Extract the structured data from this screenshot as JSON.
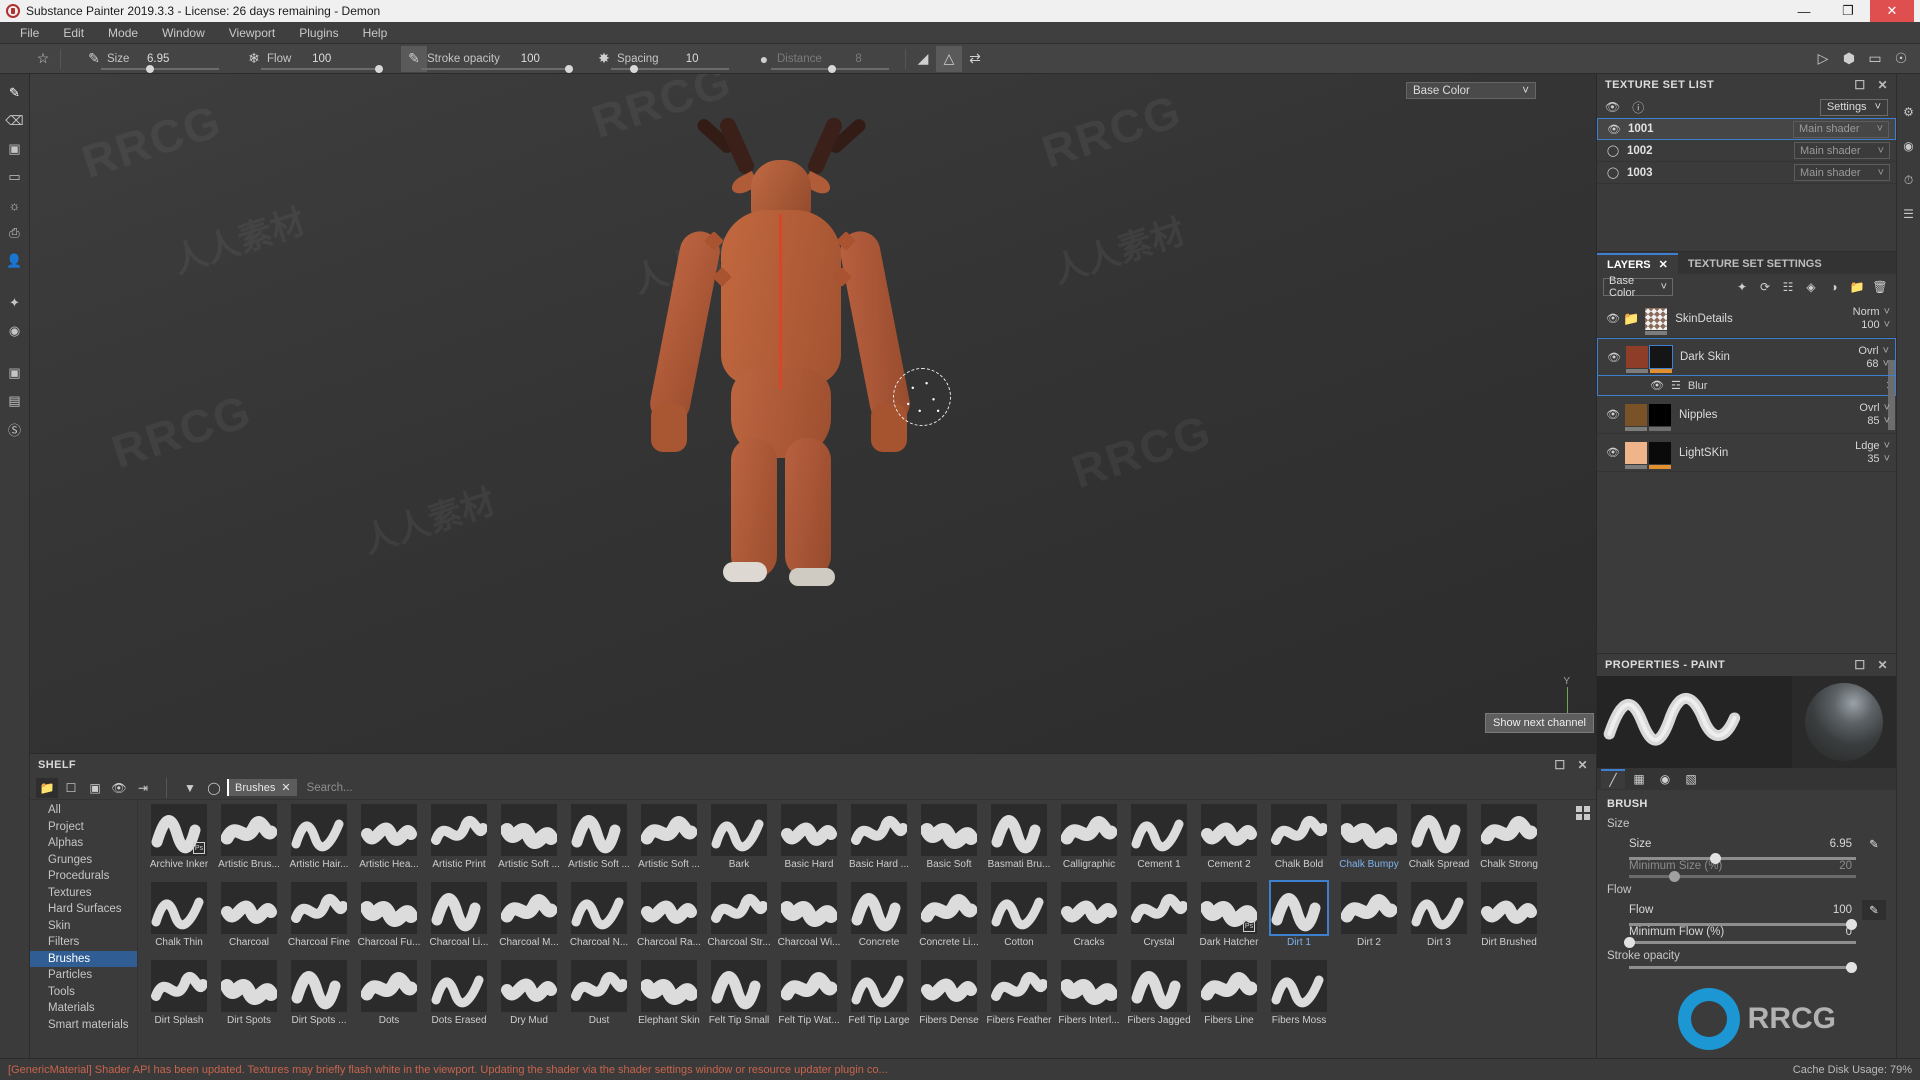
{
  "titlebar": {
    "title": "Substance Painter 2019.3.3 - License: 26 days remaining - Demon",
    "minimize": "—",
    "maximize": "❐",
    "close": "✕"
  },
  "menubar": {
    "items": [
      "File",
      "Edit",
      "Mode",
      "Window",
      "Viewport",
      "Plugins",
      "Help"
    ]
  },
  "toolbar": {
    "params": [
      {
        "label": "Size",
        "value": "6.95",
        "fill": 38,
        "dim": false
      },
      {
        "label": "Flow",
        "value": "100",
        "fill": 97,
        "dim": false
      },
      {
        "label": "Stroke opacity",
        "value": "100",
        "fill": 97,
        "dim": false
      },
      {
        "label": "Spacing",
        "value": "10",
        "fill": 16,
        "dim": false
      },
      {
        "label": "Distance",
        "value": "8",
        "fill": 48,
        "dim": true
      }
    ],
    "icons": {
      "brush": "brush-icon",
      "star": "star-shape-icon",
      "flow_brush": "flow-brush-icon",
      "opacity_brush": "opacity-brush-icon",
      "spacing_dots": "spacing-dots-icon",
      "distance": "distance-icon",
      "curve": "curve-icon",
      "symmetry": "symmetry-icon",
      "symmetry_transform": "symmetry-transform-icon"
    },
    "right_icons": [
      "viewport-layout-icon",
      "material-sphere-icon",
      "camera-view-icon",
      "screenshot-icon"
    ]
  },
  "leftrail": {
    "items": [
      "paint-tool-icon",
      "eraser-tool-icon",
      "projection-tool-icon",
      "polygon-fill-icon",
      "smudge-tool-icon",
      "clone-tool-icon",
      "material-picker-icon",
      "particle-tool-icon",
      "physical-paint-icon",
      "photoshop-bridge-icon",
      "document-icon",
      "substance-icon"
    ]
  },
  "viewport": {
    "channel_dropdown": "Base Color",
    "axis_label": "Y",
    "tooltip": "Show next channel"
  },
  "shelf": {
    "title": "SHELF",
    "tools": [
      "folder-icon",
      "new-file-icon",
      "save-icon",
      "hide-icon",
      "import-icon"
    ],
    "filter_icons": [
      "filter-funnel-icon",
      "circle-icon"
    ],
    "filter_tag": "Brushes",
    "search_placeholder": "Search...",
    "categories": [
      "All",
      "Project",
      "Alphas",
      "Grunges",
      "Procedurals",
      "Textures",
      "Hard Surfaces",
      "Skin",
      "Filters",
      "Brushes",
      "Particles",
      "Tools",
      "Materials",
      "Smart materials"
    ],
    "selected_category": "Brushes",
    "selected_brush": "Dirt 1",
    "brushes": [
      {
        "name": "Archive Inker",
        "ps": true
      },
      {
        "name": "Artistic Brus..."
      },
      {
        "name": "Artistic Hair..."
      },
      {
        "name": "Artistic Hea..."
      },
      {
        "name": "Artistic Print"
      },
      {
        "name": "Artistic Soft ..."
      },
      {
        "name": "Artistic Soft ..."
      },
      {
        "name": "Artistic Soft ..."
      },
      {
        "name": "Bark"
      },
      {
        "name": "Basic Hard"
      },
      {
        "name": "Basic Hard ..."
      },
      {
        "name": "Basic Soft"
      },
      {
        "name": "Basmati Bru..."
      },
      {
        "name": "Calligraphic"
      },
      {
        "name": "Cement 1"
      },
      {
        "name": "Cement 2"
      },
      {
        "name": "Chalk Bold"
      },
      {
        "name": "Chalk Bumpy",
        "highlight": true
      },
      {
        "name": "Chalk Spread"
      },
      {
        "name": "Chalk Strong"
      },
      {
        "name": "Chalk Thin"
      },
      {
        "name": "Charcoal"
      },
      {
        "name": "Charcoal Fine"
      },
      {
        "name": "Charcoal Fu..."
      },
      {
        "name": "Charcoal Li..."
      },
      {
        "name": "Charcoal M..."
      },
      {
        "name": "Charcoal N..."
      },
      {
        "name": "Charcoal Ra..."
      },
      {
        "name": "Charcoal Str..."
      },
      {
        "name": "Charcoal Wi..."
      },
      {
        "name": "Concrete"
      },
      {
        "name": "Concrete Li..."
      },
      {
        "name": "Cotton"
      },
      {
        "name": "Cracks"
      },
      {
        "name": "Crystal"
      },
      {
        "name": "Dark Hatcher",
        "ps": true
      },
      {
        "name": "Dirt 1",
        "selected": true
      },
      {
        "name": "Dirt 2"
      },
      {
        "name": "Dirt 3"
      },
      {
        "name": "Dirt Brushed"
      },
      {
        "name": "Dirt Splash"
      },
      {
        "name": "Dirt Spots"
      },
      {
        "name": "Dirt Spots ..."
      },
      {
        "name": "Dots"
      },
      {
        "name": "Dots Erased"
      },
      {
        "name": "Dry Mud"
      },
      {
        "name": "Dust"
      },
      {
        "name": "Elephant Skin"
      },
      {
        "name": "Felt Tip Small"
      },
      {
        "name": "Felt Tip Wat..."
      },
      {
        "name": "Fetl Tip Large"
      },
      {
        "name": "Fibers Dense"
      },
      {
        "name": "Fibers Feather"
      },
      {
        "name": "Fibers Interl..."
      },
      {
        "name": "Fibers Jagged"
      },
      {
        "name": "Fibers Line"
      },
      {
        "name": "Fibers Moss"
      }
    ]
  },
  "texture_set_list": {
    "title": "TEXTURE SET LIST",
    "settings_label": "Settings",
    "tool_icons": [
      "eye-check-icon",
      "info-circle-icon"
    ],
    "rows": [
      {
        "name": "1001",
        "shader": "Main shader",
        "visible": true,
        "selected": true
      },
      {
        "name": "1002",
        "shader": "Main shader",
        "visible": false,
        "selected": false
      },
      {
        "name": "1003",
        "shader": "Main shader",
        "visible": false,
        "selected": false
      }
    ]
  },
  "layers_panel": {
    "tabs": [
      {
        "label": "LAYERS",
        "active": true,
        "closable": true
      },
      {
        "label": "TEXTURE SET SETTINGS",
        "active": false,
        "closable": false
      }
    ],
    "channel": "Base Color",
    "tool_icons": [
      "magic-wand-icon",
      "add-effect-icon",
      "add-fill-layer-icon",
      "add-paint-layer-icon",
      "add-adjustment-icon",
      "add-folder-icon",
      "delete-icon"
    ],
    "layers": [
      {
        "name": "SkinDetails",
        "blend": "Norm",
        "opacity": "100",
        "type": "folder",
        "visible": true,
        "selected": false,
        "thumb": "checker"
      },
      {
        "name": "Dark Skin",
        "blend": "Ovrl",
        "opacity": "68",
        "type": "paint",
        "visible": true,
        "selected": true,
        "thumb": "darkskin",
        "effects": [
          {
            "name": "Blur",
            "visible": true,
            "icon": "blur-icon"
          }
        ]
      },
      {
        "name": "Nipples",
        "blend": "Ovrl",
        "opacity": "85",
        "type": "paint",
        "visible": true,
        "selected": false,
        "thumb": "nipples"
      },
      {
        "name": "LightSKin",
        "blend": "Ldge",
        "opacity": "35",
        "type": "paint",
        "visible": true,
        "selected": false,
        "thumb": "lightskin"
      }
    ]
  },
  "properties": {
    "title": "PROPERTIES - PAINT",
    "tabs": [
      "brush-tab-icon",
      "alpha-tab-icon",
      "stencil-tab-icon",
      "gradient-tab-icon"
    ],
    "section": "BRUSH",
    "groups": [
      {
        "label": "Size",
        "rows": [
          {
            "label": "Size",
            "value": "6.95",
            "fill": 38,
            "dim": false,
            "button": "size-jitter-icon"
          },
          {
            "label": "Minimum Size (%)",
            "value": "20",
            "fill": 20,
            "dim": true
          }
        ]
      },
      {
        "label": "Flow",
        "rows": [
          {
            "label": "Flow",
            "value": "100",
            "fill": 98,
            "dim": false,
            "button": "flow-jitter-icon",
            "button_on": true
          },
          {
            "label": "Minimum Flow (%)",
            "value": "0",
            "fill": 0,
            "dim": false
          }
        ]
      },
      {
        "label": "Stroke opacity",
        "rows": [
          {
            "label": "",
            "value": "",
            "fill": 98,
            "dim": false
          }
        ]
      }
    ]
  },
  "right_strip": {
    "icons": [
      "display-settings-icon",
      "shader-settings-icon",
      "history-icon",
      "log-icon"
    ]
  },
  "status": {
    "message": "[GenericMaterial] Shader API has been updated. Textures may briefly flash white in the viewport. Updating the shader via the shader settings window or resource updater plugin co...",
    "cache": "Cache Disk Usage:  79%",
    "accent_color": "#c8644c"
  },
  "watermarks": {
    "latin": "RRCG",
    "cjk": "人人素材",
    "logo_text": "RRCG"
  }
}
